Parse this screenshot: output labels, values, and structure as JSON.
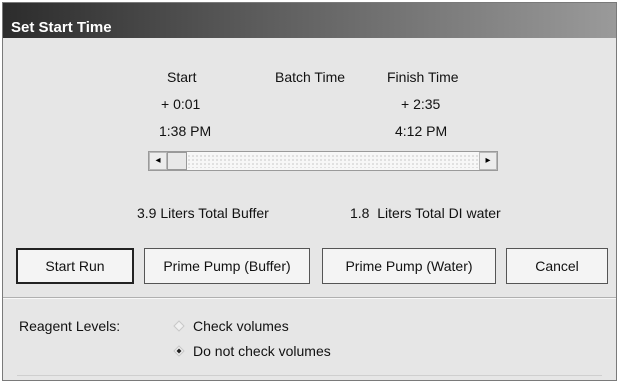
{
  "window": {
    "title": "Set Start Time"
  },
  "schedule": {
    "start_header": "Start",
    "batch_time_header": "Batch Time",
    "finish_header": "Finish Time",
    "start_offset": "+ 0:01",
    "finish_offset": "+ 2:35",
    "start_clock": "1:38 PM",
    "finish_clock": "4:12 PM"
  },
  "scrollbar": {
    "left_arrow_icon": "scroll-left-arrow-icon",
    "right_arrow_icon": "scroll-right-arrow-icon",
    "left_arrow_glyph": "◂",
    "right_arrow_glyph": "▸"
  },
  "volumes": {
    "buffer": "3.9 Liters Total Buffer",
    "water": "1.8  Liters Total DI water"
  },
  "buttons": {
    "start_run": "Start Run",
    "prime_buffer": "Prime Pump (Buffer)",
    "prime_water": "Prime Pump (Water)",
    "cancel": "Cancel"
  },
  "reagent": {
    "label": "Reagent Levels:",
    "options": [
      {
        "label": "Check volumes",
        "selected": false
      },
      {
        "label": "Do not check volumes",
        "selected": true
      }
    ]
  },
  "colors": {
    "window_bg": "#e6e6e6",
    "title_bar_dark": "#2c2c2c",
    "title_bar_light": "#9a9a9a",
    "title_text": "#ffffff"
  }
}
